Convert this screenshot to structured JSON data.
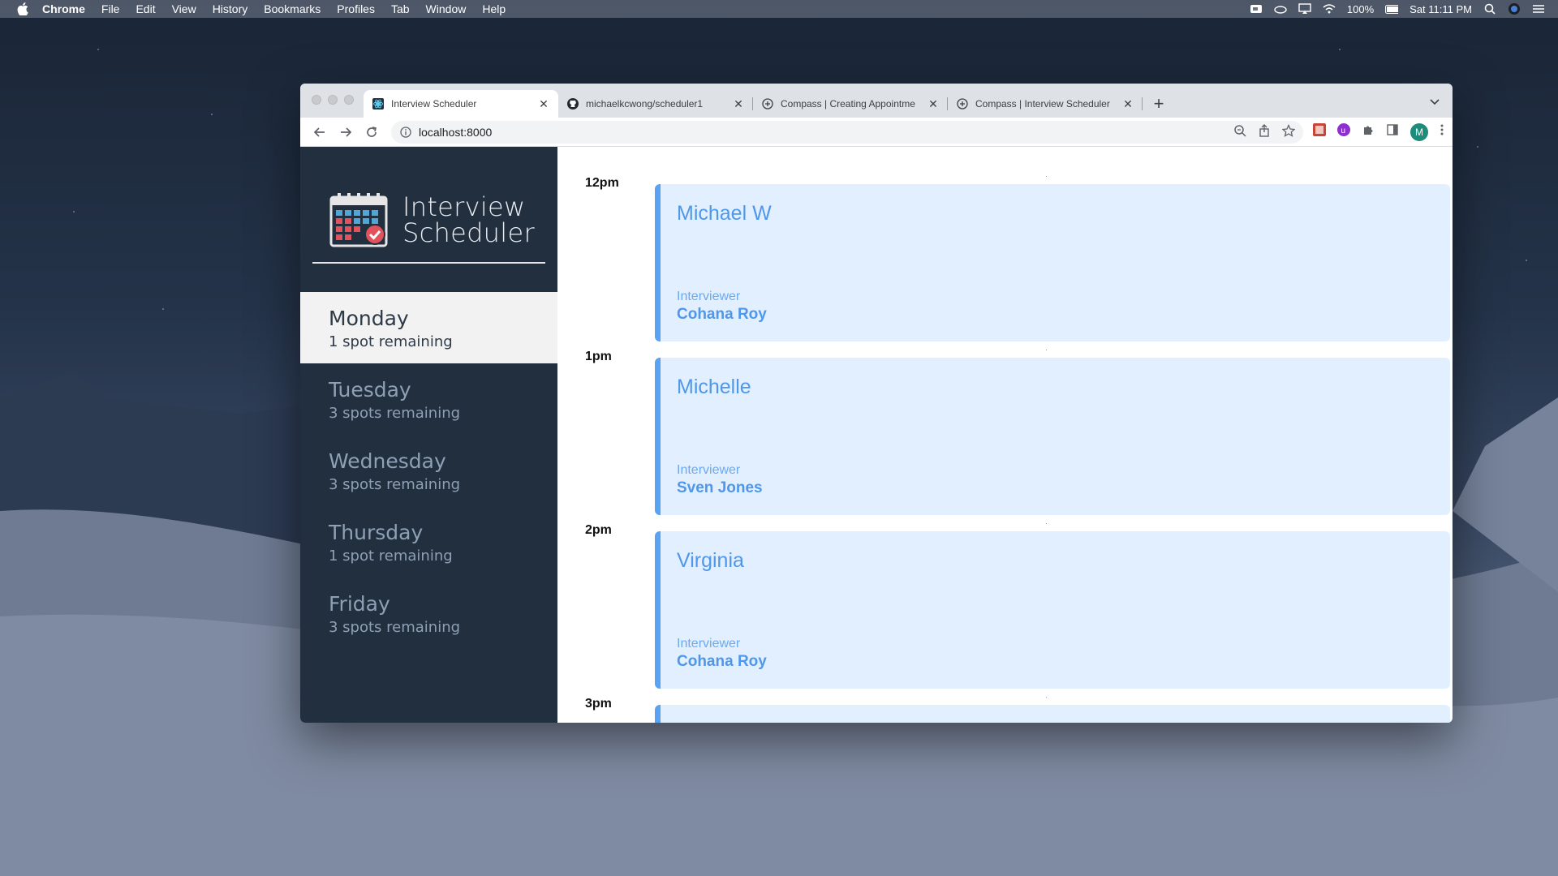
{
  "menubar": {
    "app": "Chrome",
    "items": [
      "File",
      "Edit",
      "View",
      "History",
      "Bookmarks",
      "Profiles",
      "Tab",
      "Window",
      "Help"
    ],
    "battery": "100%",
    "clock": "Sat 11:11 PM"
  },
  "browser": {
    "tabs": [
      {
        "title": "Interview Scheduler",
        "icon": "react-icon",
        "active": true
      },
      {
        "title": "michaelkcwong/scheduler1",
        "icon": "github-icon",
        "active": false
      },
      {
        "title": "Compass | Creating Appointme",
        "icon": "globe-icon",
        "active": false
      },
      {
        "title": "Compass | Interview Scheduler",
        "icon": "globe-icon",
        "active": false
      }
    ],
    "url": "localhost:8000",
    "profile_initial": "M"
  },
  "app": {
    "brand_line1": "Interview",
    "brand_line2": "Scheduler",
    "days": [
      {
        "name": "Monday",
        "spots": "1 spot remaining",
        "selected": true
      },
      {
        "name": "Tuesday",
        "spots": "3 spots remaining",
        "selected": false
      },
      {
        "name": "Wednesday",
        "spots": "3 spots remaining",
        "selected": false
      },
      {
        "name": "Thursday",
        "spots": "1 spot remaining",
        "selected": false
      },
      {
        "name": "Friday",
        "spots": "3 spots remaining",
        "selected": false
      }
    ],
    "appointments": [
      {
        "time": "12pm",
        "student": "Michael W",
        "interviewer_label": "Interviewer",
        "interviewer": "Cohana Roy"
      },
      {
        "time": "1pm",
        "student": "Michelle",
        "interviewer_label": "Interviewer",
        "interviewer": "Sven Jones"
      },
      {
        "time": "2pm",
        "student": "Virginia",
        "interviewer_label": "Interviewer",
        "interviewer": "Cohana Roy"
      },
      {
        "time": "3pm"
      }
    ]
  },
  "colors": {
    "sidebar": "#222f3e",
    "card_bg": "#e2efff",
    "card_accent": "#5aa2f2",
    "selected_day_bg": "#f2f2f2"
  }
}
